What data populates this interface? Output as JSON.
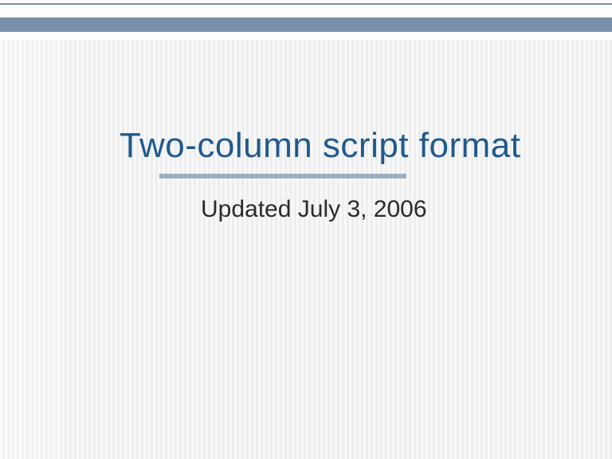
{
  "slide": {
    "title": "Two-column script format",
    "subtitle": "Updated July 3, 2006"
  }
}
